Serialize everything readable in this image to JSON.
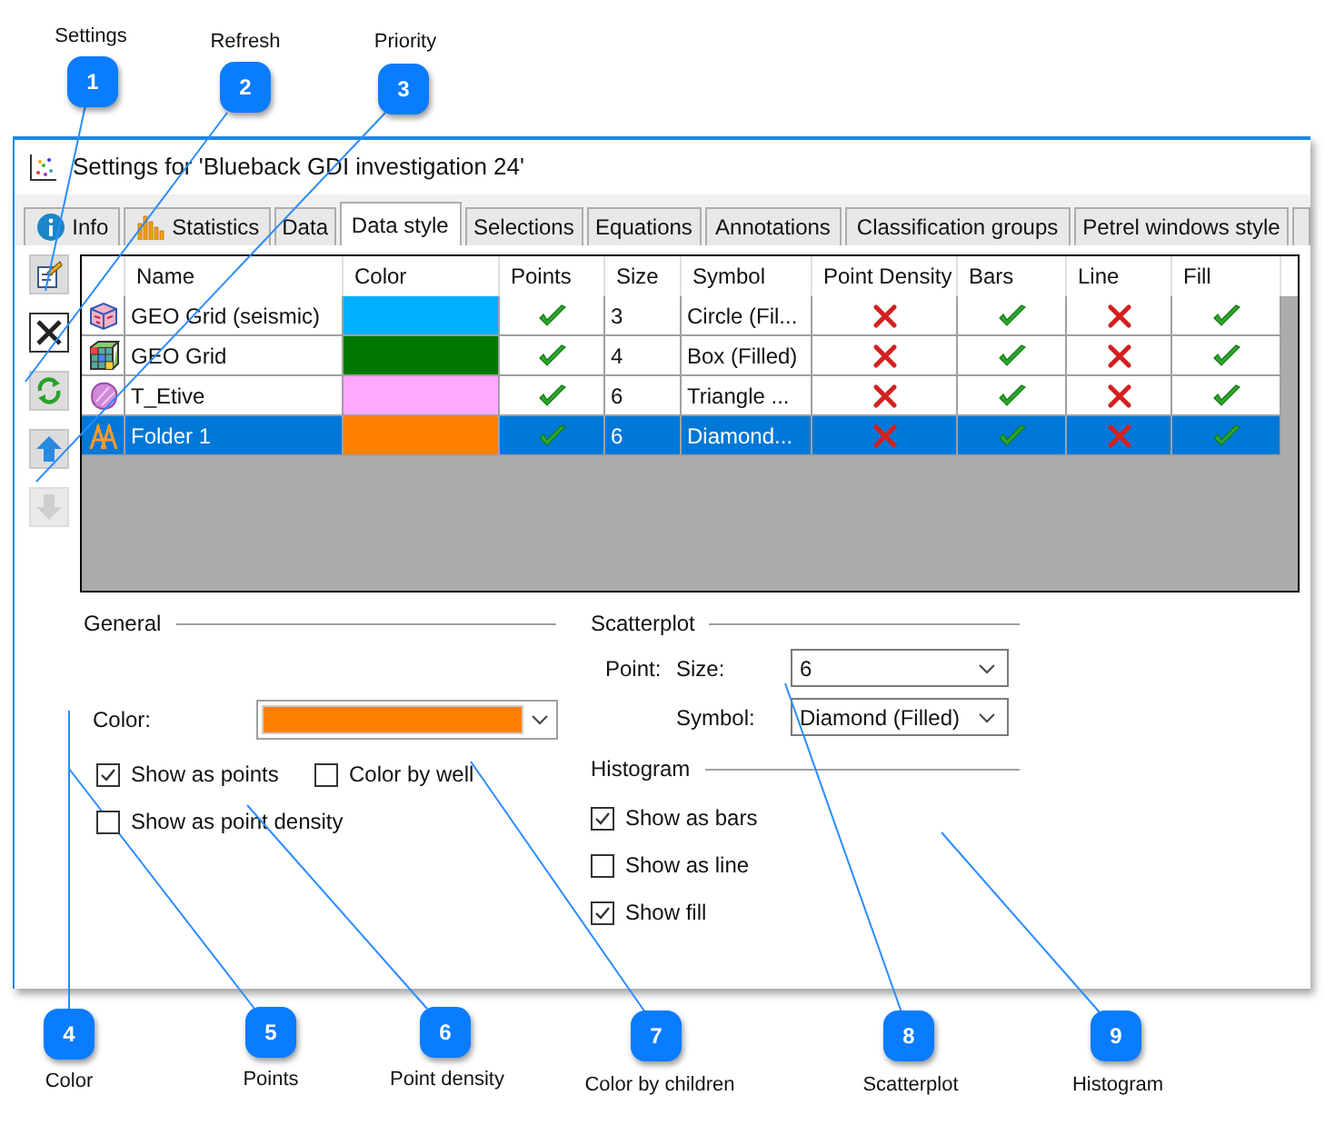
{
  "callouts": [
    {
      "number": "1",
      "label": "Settings"
    },
    {
      "number": "2",
      "label": "Refresh"
    },
    {
      "number": "3",
      "label": "Priority"
    },
    {
      "number": "4",
      "label": "Color"
    },
    {
      "number": "5",
      "label": "Points"
    },
    {
      "number": "6",
      "label": "Point density"
    },
    {
      "number": "7",
      "label": "Color by children"
    },
    {
      "number": "8",
      "label": "Scatterplot"
    },
    {
      "number": "9",
      "label": "Histogram"
    }
  ],
  "window": {
    "title": "Settings for 'Blueback GDI investigation 24'"
  },
  "tabs": [
    {
      "label": "Info",
      "kind": "info",
      "selected": false
    },
    {
      "label": "Statistics",
      "kind": "chart",
      "selected": false
    },
    {
      "label": "Data",
      "kind": "plain",
      "selected": false
    },
    {
      "label": "Data style",
      "kind": "plain",
      "selected": true
    },
    {
      "label": "Selections",
      "kind": "plain",
      "selected": false
    },
    {
      "label": "Equations",
      "kind": "plain",
      "selected": false
    },
    {
      "label": "Annotations",
      "kind": "plain",
      "selected": false
    },
    {
      "label": "Classification groups",
      "kind": "plain",
      "selected": false
    },
    {
      "label": "Petrel windows style",
      "kind": "plain",
      "selected": false
    }
  ],
  "toolbar": [
    {
      "kind": "settings",
      "disabled": false
    },
    {
      "kind": "delete",
      "disabled": false
    },
    {
      "kind": "refresh",
      "disabled": false
    },
    {
      "kind": "up",
      "disabled": false
    },
    {
      "kind": "down",
      "disabled": true
    }
  ],
  "table": {
    "columns": [
      "Name",
      "Color",
      "Points",
      "Size",
      "Symbol",
      "Point Density",
      "Bars",
      "Line",
      "Fill"
    ],
    "rows": [
      {
        "kind": "seismic",
        "name": "GEO Grid (seismic)",
        "color": "#00b0ff",
        "points": true,
        "size": "3",
        "symbol": "Circle (Fil...",
        "point_density": false,
        "bars": true,
        "line": false,
        "fill": true,
        "selected": false
      },
      {
        "kind": "grid",
        "name": "GEO Grid",
        "color": "#007800",
        "points": true,
        "size": "4",
        "symbol": "Box (Filled)",
        "point_density": false,
        "bars": true,
        "line": false,
        "fill": true,
        "selected": false
      },
      {
        "kind": "surface",
        "name": "T_Etive",
        "color": "#ffa8ff",
        "points": true,
        "size": "6",
        "symbol": "Triangle ...",
        "point_density": false,
        "bars": true,
        "line": false,
        "fill": true,
        "selected": false
      },
      {
        "kind": "folder",
        "name": "Folder 1",
        "color": "#ff8000",
        "points": true,
        "size": "6",
        "symbol": "Diamond...",
        "point_density": false,
        "bars": true,
        "line": false,
        "fill": true,
        "selected": true
      }
    ]
  },
  "general": {
    "title": "General",
    "color_label": "Color:",
    "color": "#ff8000",
    "options": [
      {
        "label": "Show as points",
        "checked": true
      },
      {
        "label": "Color by well",
        "checked": false
      },
      {
        "label": "Show as point density",
        "checked": false
      }
    ]
  },
  "scatterplot": {
    "title": "Scatterplot",
    "point_label": "Point:",
    "size_label": "Size:",
    "size": "6",
    "symbol_label": "Symbol:",
    "symbol": "Diamond (Filled)"
  },
  "histogram": {
    "title": "Histogram",
    "options": [
      {
        "label": "Show as bars",
        "checked": true
      },
      {
        "label": "Show as line",
        "checked": false
      },
      {
        "label": "Show fill",
        "checked": true
      }
    ]
  }
}
